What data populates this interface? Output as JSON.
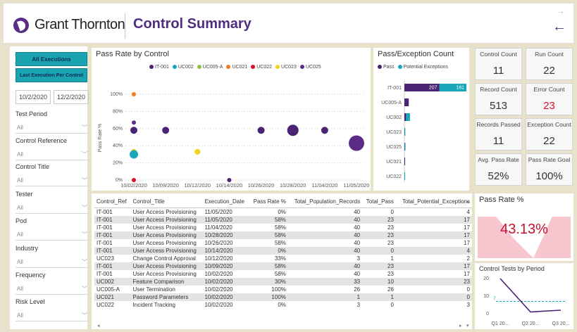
{
  "header": {
    "brand": "Grant Thornton",
    "title": "Control Summary"
  },
  "sidebar": {
    "btn_all": "All Executions",
    "btn_last": "Last Execution Per Control",
    "date_from": "10/2/2020",
    "date_to": "12/2/2020",
    "filters": [
      {
        "label": "Test Period",
        "value": "All"
      },
      {
        "label": "Control Reference",
        "value": "All"
      },
      {
        "label": "Control Title",
        "value": "All"
      },
      {
        "label": "Tester",
        "value": "All"
      },
      {
        "label": "Pod",
        "value": "All"
      },
      {
        "label": "Industry",
        "value": "All"
      },
      {
        "label": "Frequency",
        "value": "All"
      },
      {
        "label": "Risk Level",
        "value": "All"
      }
    ]
  },
  "scatter": {
    "title": "Pass Rate by Control",
    "ylabel": "Pass Rate %",
    "legend": [
      "IT-001",
      "UC002",
      "UC005-A",
      "UC021",
      "UC022",
      "UC023",
      "UC025"
    ],
    "colors": {
      "IT-001": "#4a2373",
      "UC002": "#16a8b8",
      "UC005-A": "#8fc23c",
      "UC021": "#f07b22",
      "UC022": "#d6112a",
      "UC023": "#f2d21e",
      "UC025": "#5b2d86"
    },
    "yticks": [
      "100%",
      "80%",
      "60%",
      "40%",
      "20%",
      "0%"
    ],
    "xticks": [
      "10/02/2020",
      "10/09/2020",
      "10/12/2020",
      "10/14/2020",
      "10/26/2020",
      "10/28/2020",
      "11/04/2020",
      "11/05/2020"
    ]
  },
  "bars": {
    "title": "Pass/Exception Count",
    "legend": [
      "Pass",
      "Potential Exceptions"
    ],
    "colors": {
      "pass": "#4a2373",
      "exc": "#16a8b8"
    },
    "labels": [
      "IT-001",
      "UC005-A",
      "UC002",
      "UC023",
      "UC025",
      "UC021",
      "UC022"
    ],
    "values_display": {
      "it001_pass": "207",
      "it001_exc": "161"
    }
  },
  "chart_data": [
    {
      "type": "scatter",
      "title": "Pass Rate by Control",
      "xlabel": "",
      "ylabel": "Pass Rate %",
      "ylim": [
        0,
        1
      ],
      "points": [
        {
          "series": "UC021",
          "x": "10/02/2020",
          "y": 1.0
        },
        {
          "series": "UC025",
          "x": "10/02/2020",
          "y": 0.67
        },
        {
          "series": "IT-001",
          "x": "10/02/2020",
          "y": 0.58
        },
        {
          "series": "UC023",
          "x": "10/02/2020",
          "y": 0.33
        },
        {
          "series": "UC002",
          "x": "10/02/2020",
          "y": 0.3
        },
        {
          "series": "UC022",
          "x": "10/02/2020",
          "y": 0.0
        },
        {
          "series": "IT-001",
          "x": "10/09/2020",
          "y": 0.58
        },
        {
          "series": "UC023",
          "x": "10/12/2020",
          "y": 0.33
        },
        {
          "series": "IT-001",
          "x": "10/14/2020",
          "y": 0.0
        },
        {
          "series": "IT-001",
          "x": "10/26/2020",
          "y": 0.58
        },
        {
          "series": "IT-001",
          "x": "10/28/2020",
          "y": 0.58
        },
        {
          "series": "IT-001",
          "x": "11/04/2020",
          "y": 0.58
        },
        {
          "series": "UC025",
          "x": "11/05/2020",
          "y": 0.43
        }
      ]
    },
    {
      "type": "bar",
      "title": "Pass/Exception Count",
      "categories": [
        "IT-001",
        "UC005-A",
        "UC002",
        "UC023",
        "UC025",
        "UC021",
        "UC022"
      ],
      "series": [
        {
          "name": "Pass",
          "values": [
            207,
            26,
            10,
            1,
            2,
            1,
            0
          ]
        },
        {
          "name": "Potential Exceptions",
          "values": [
            161,
            0,
            23,
            2,
            1,
            0,
            3
          ]
        }
      ]
    },
    {
      "type": "area",
      "title": "Pass Rate %",
      "values": [
        0.82,
        0.82,
        0.36,
        0.0,
        0.82,
        0.82
      ],
      "label": "43.13%"
    },
    {
      "type": "line",
      "title": "Control Tests by Period",
      "categories": [
        "Q1 20...",
        "Q2 20...",
        "Q3 20..."
      ],
      "values": [
        20,
        1,
        2
      ],
      "reference": 7,
      "yticks": [
        "20",
        "10",
        "0"
      ]
    }
  ],
  "kpis": [
    {
      "label": "Control Count",
      "value": "11",
      "color": "#333333"
    },
    {
      "label": "Run Count",
      "value": "22",
      "color": "#333333"
    },
    {
      "label": "Record Count",
      "value": "513",
      "color": "#333333"
    },
    {
      "label": "Error Count",
      "value": "23",
      "color": "#d6112a"
    },
    {
      "label": "Records Passed",
      "value": "11",
      "color": "#333333"
    },
    {
      "label": "Exception Count",
      "value": "22",
      "color": "#333333"
    },
    {
      "label": "Avg. Pass Rate",
      "value": "52%",
      "color": "#333333"
    },
    {
      "label": "Pass Rate Goal",
      "value": "100%",
      "color": "#333333"
    }
  ],
  "passrate": {
    "title": "Pass Rate %",
    "value": "43.13%"
  },
  "trend": {
    "title": "Control Tests by Period",
    "marker": "7"
  },
  "table": {
    "headers": [
      "Control_Ref",
      "Control_Title",
      "Execution_Date",
      "Pass Rate %",
      "Total_Population_Records",
      "Total_Pass",
      "Total_Potential_Exceptions"
    ],
    "rows": [
      [
        "IT-001",
        "User Access Provisioning",
        "11/05/2020",
        "0%",
        "40",
        "0",
        "4"
      ],
      [
        "IT-001",
        "User Access Provisioning",
        "11/05/2020",
        "58%",
        "40",
        "23",
        "17"
      ],
      [
        "IT-001",
        "User Access Provisioning",
        "11/04/2020",
        "58%",
        "40",
        "23",
        "17"
      ],
      [
        "IT-001",
        "User Access Provisioning",
        "10/28/2020",
        "58%",
        "40",
        "23",
        "17"
      ],
      [
        "IT-001",
        "User Access Provisioning",
        "10/26/2020",
        "58%",
        "40",
        "23",
        "17"
      ],
      [
        "IT-001",
        "User Access Provisioning",
        "10/14/2020",
        "0%",
        "40",
        "0",
        "4"
      ],
      [
        "UC023",
        "Change Control Approval",
        "10/12/2020",
        "33%",
        "3",
        "1",
        "2"
      ],
      [
        "IT-001",
        "User Access Provisioning",
        "10/09/2020",
        "58%",
        "40",
        "23",
        "17"
      ],
      [
        "IT-001",
        "User Access Provisioning",
        "10/02/2020",
        "58%",
        "40",
        "23",
        "17"
      ],
      [
        "UC002",
        "Feature Comparison",
        "10/02/2020",
        "30%",
        "33",
        "10",
        "23"
      ],
      [
        "UC005-A",
        "User Termination",
        "10/02/2020",
        "100%",
        "26",
        "26",
        "0"
      ],
      [
        "UC021",
        "Password Parameters",
        "10/02/2020",
        "100%",
        "1",
        "1",
        "0"
      ],
      [
        "UC022",
        "Incident Tracking",
        "10/02/2020",
        "0%",
        "3",
        "0",
        "3"
      ]
    ]
  }
}
